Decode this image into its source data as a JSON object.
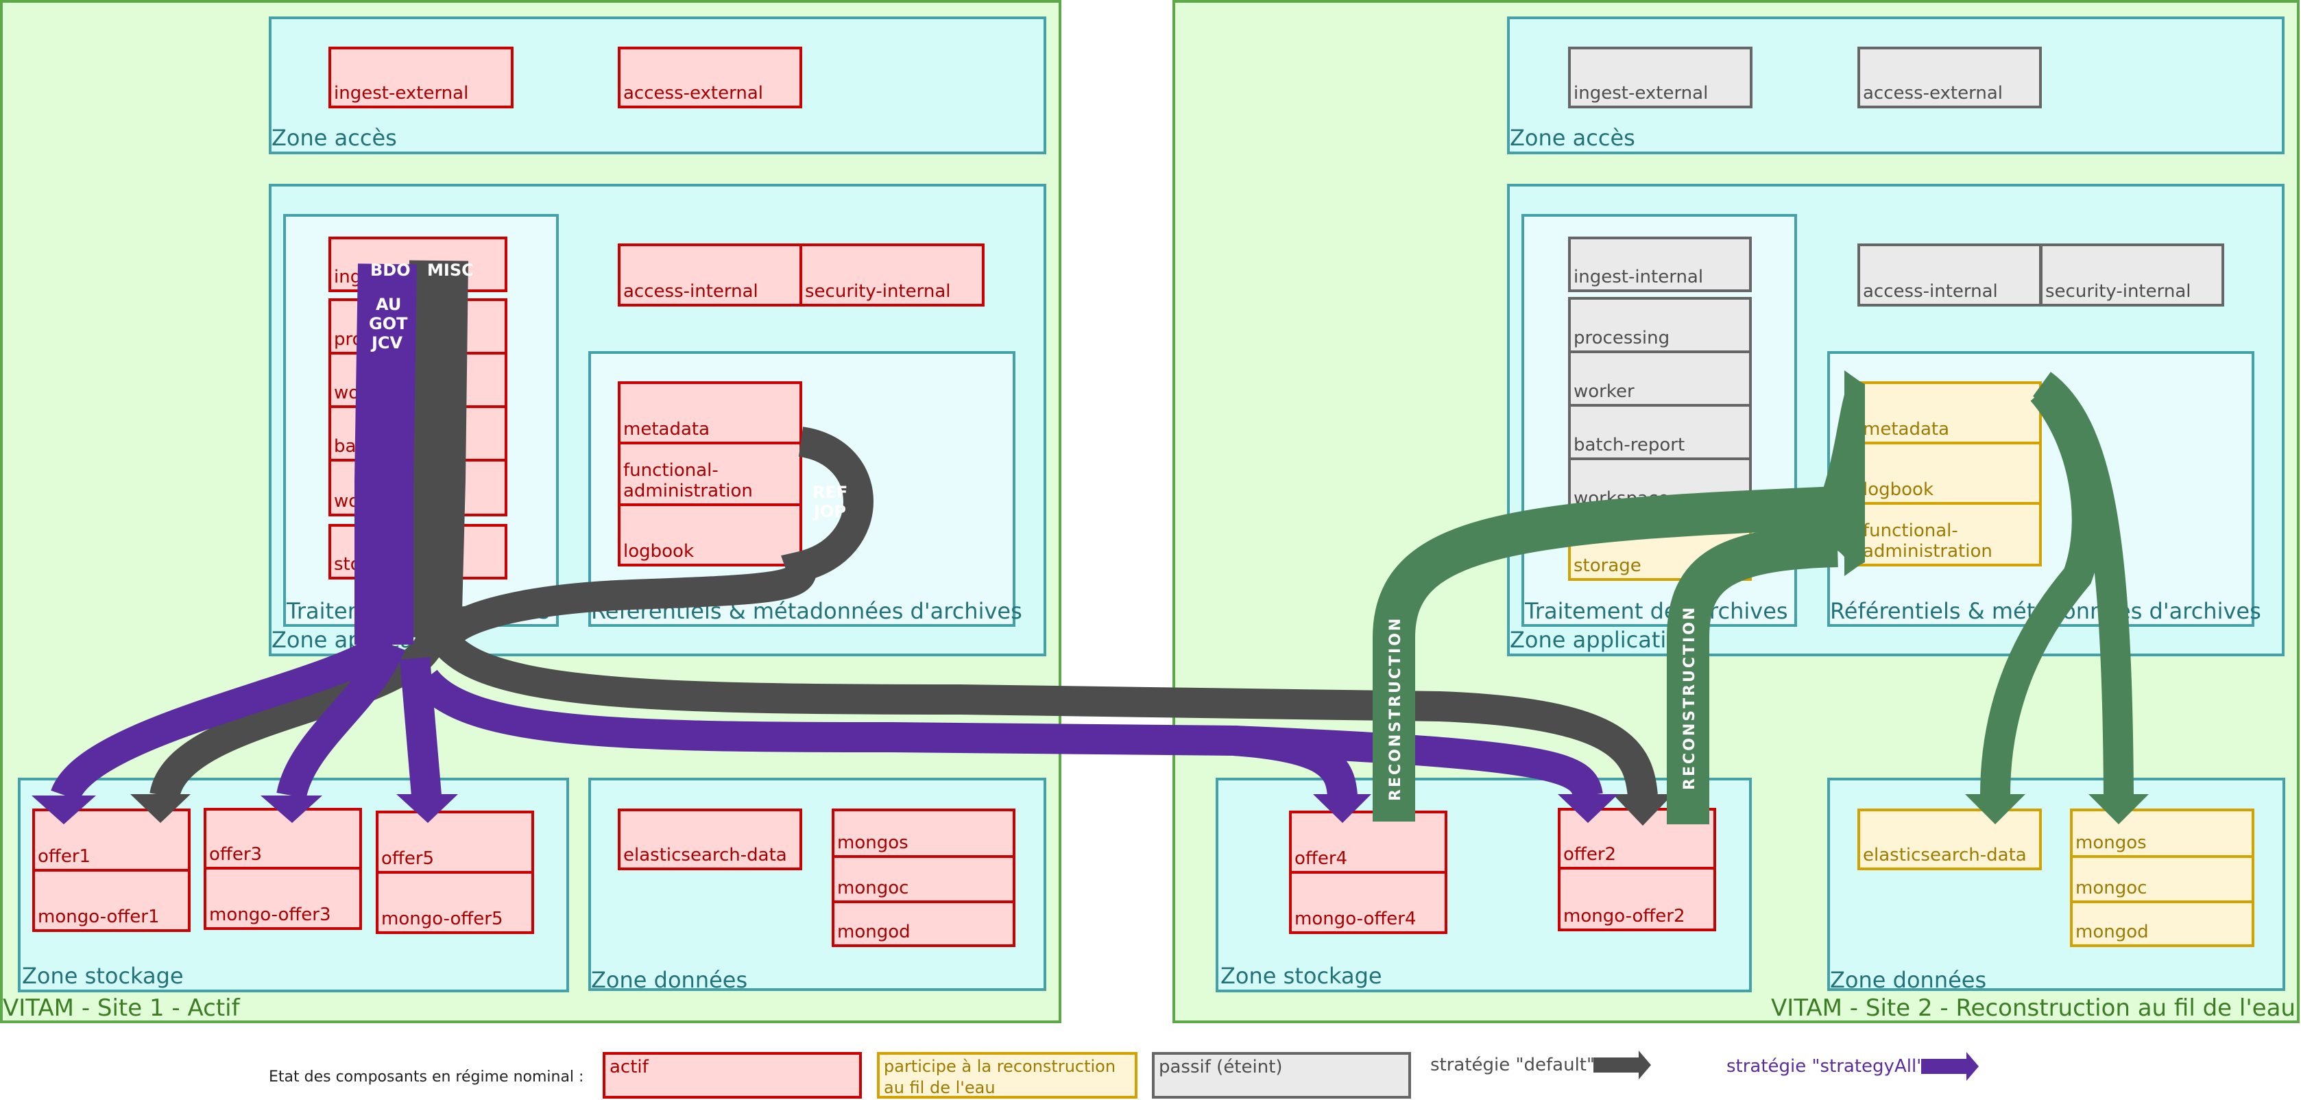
{
  "colors": {
    "actif_fill": "#ffd7d7",
    "actif_border": "#cc0000",
    "recon_fill": "#fef5d6",
    "recon_border": "#d3a100",
    "passif_fill": "#eaeaea",
    "passif_border": "#666666",
    "strategy_default": "#4d4d4d",
    "strategy_all": "#5a2ca0",
    "reconstruction": "#4a8458",
    "site_fill": "#e1fdd8",
    "zone_fill": "#d5fbf9"
  },
  "site1": {
    "title": "VITAM - Site 1 - Actif",
    "zone_acces": {
      "label": "Zone accès",
      "components": [
        "ingest-external",
        "access-external"
      ]
    },
    "zone_applicative": {
      "label": "Zone applicative",
      "traitement": {
        "label": "Traitement des archives",
        "components": [
          "ingest-internal",
          "processing",
          "worker",
          "batch-report",
          "workspace",
          "storage"
        ]
      },
      "internal": [
        "access-internal",
        "security-internal"
      ],
      "referentiels": {
        "label": "Référentiels & métadonnées d'archives",
        "components": [
          "metadata",
          "functional-administration",
          "logbook"
        ]
      }
    },
    "zone_stockage": {
      "label": "Zone stockage",
      "offers": [
        [
          "offer1",
          "mongo-offer1"
        ],
        [
          "offer3",
          "mongo-offer3"
        ],
        [
          "offer5",
          "mongo-offer5"
        ]
      ]
    },
    "zone_donnees": {
      "label": "Zone données",
      "components": [
        "elasticsearch-data",
        "mongos",
        "mongoc",
        "mongod"
      ]
    },
    "flow_labels": {
      "bdo": "BDO",
      "au_got_jcv": [
        "AU",
        "GOT",
        "JCV"
      ],
      "misc": "MISC",
      "ref_jop": [
        "REF",
        "JOP"
      ]
    }
  },
  "site2": {
    "title": "VITAM - Site 2 - Reconstruction au fil de l'eau",
    "zone_acces": {
      "label": "Zone accès",
      "components": [
        "ingest-external",
        "access-external"
      ]
    },
    "zone_applicative": {
      "label": "Zone applicative",
      "traitement": {
        "label": "Traitement des archives",
        "components": [
          "ingest-internal",
          "processing",
          "worker",
          "batch-report",
          "workspace",
          "storage"
        ]
      },
      "internal": [
        "access-internal",
        "security-internal"
      ],
      "referentiels": {
        "label": "Référentiels & métadonnées d'archives",
        "components": [
          "metadata",
          "logbook",
          "functional-administration"
        ]
      }
    },
    "zone_stockage": {
      "label": "Zone stockage",
      "offers": [
        [
          "offer4",
          "mongo-offer4"
        ],
        [
          "offer2",
          "mongo-offer2"
        ]
      ]
    },
    "zone_donnees": {
      "label": "Zone données",
      "components": [
        "elasticsearch-data",
        "mongos",
        "mongoc",
        "mongod"
      ]
    },
    "flow_labels": {
      "reconstruction": "RECONSTRUCTION"
    }
  },
  "legend": {
    "caption": "Etat des composants en régime nominal :",
    "states": [
      "actif",
      "participe à la reconstruction au fil de l'eau",
      "passif (éteint)"
    ],
    "strategy_default": "stratégie \"default\"",
    "strategy_all": "stratégie \"strategyAll\""
  }
}
